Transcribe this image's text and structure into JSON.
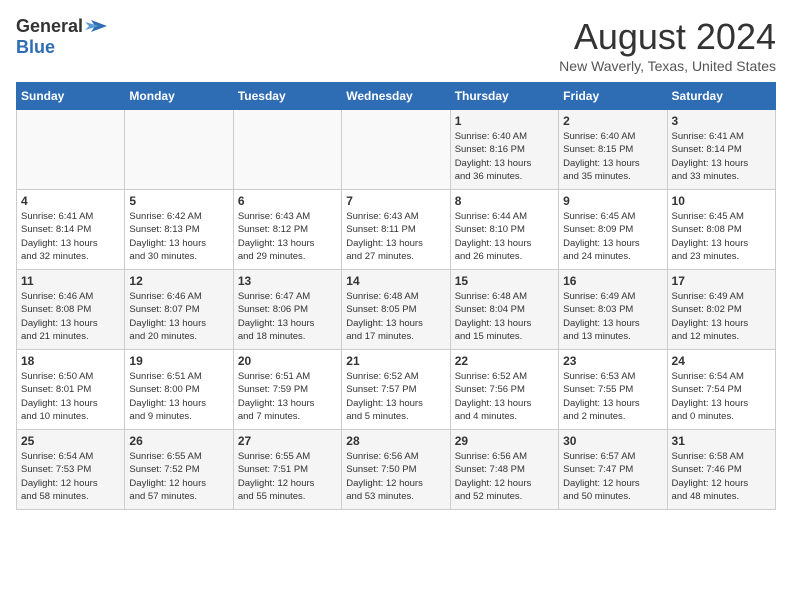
{
  "header": {
    "logo_general": "General",
    "logo_blue": "Blue",
    "month_title": "August 2024",
    "location": "New Waverly, Texas, United States"
  },
  "calendar": {
    "weekdays": [
      "Sunday",
      "Monday",
      "Tuesday",
      "Wednesday",
      "Thursday",
      "Friday",
      "Saturday"
    ],
    "weeks": [
      [
        {
          "day": "",
          "info": ""
        },
        {
          "day": "",
          "info": ""
        },
        {
          "day": "",
          "info": ""
        },
        {
          "day": "",
          "info": ""
        },
        {
          "day": "1",
          "info": "Sunrise: 6:40 AM\nSunset: 8:16 PM\nDaylight: 13 hours\nand 36 minutes."
        },
        {
          "day": "2",
          "info": "Sunrise: 6:40 AM\nSunset: 8:15 PM\nDaylight: 13 hours\nand 35 minutes."
        },
        {
          "day": "3",
          "info": "Sunrise: 6:41 AM\nSunset: 8:14 PM\nDaylight: 13 hours\nand 33 minutes."
        }
      ],
      [
        {
          "day": "4",
          "info": "Sunrise: 6:41 AM\nSunset: 8:14 PM\nDaylight: 13 hours\nand 32 minutes."
        },
        {
          "day": "5",
          "info": "Sunrise: 6:42 AM\nSunset: 8:13 PM\nDaylight: 13 hours\nand 30 minutes."
        },
        {
          "day": "6",
          "info": "Sunrise: 6:43 AM\nSunset: 8:12 PM\nDaylight: 13 hours\nand 29 minutes."
        },
        {
          "day": "7",
          "info": "Sunrise: 6:43 AM\nSunset: 8:11 PM\nDaylight: 13 hours\nand 27 minutes."
        },
        {
          "day": "8",
          "info": "Sunrise: 6:44 AM\nSunset: 8:10 PM\nDaylight: 13 hours\nand 26 minutes."
        },
        {
          "day": "9",
          "info": "Sunrise: 6:45 AM\nSunset: 8:09 PM\nDaylight: 13 hours\nand 24 minutes."
        },
        {
          "day": "10",
          "info": "Sunrise: 6:45 AM\nSunset: 8:08 PM\nDaylight: 13 hours\nand 23 minutes."
        }
      ],
      [
        {
          "day": "11",
          "info": "Sunrise: 6:46 AM\nSunset: 8:08 PM\nDaylight: 13 hours\nand 21 minutes."
        },
        {
          "day": "12",
          "info": "Sunrise: 6:46 AM\nSunset: 8:07 PM\nDaylight: 13 hours\nand 20 minutes."
        },
        {
          "day": "13",
          "info": "Sunrise: 6:47 AM\nSunset: 8:06 PM\nDaylight: 13 hours\nand 18 minutes."
        },
        {
          "day": "14",
          "info": "Sunrise: 6:48 AM\nSunset: 8:05 PM\nDaylight: 13 hours\nand 17 minutes."
        },
        {
          "day": "15",
          "info": "Sunrise: 6:48 AM\nSunset: 8:04 PM\nDaylight: 13 hours\nand 15 minutes."
        },
        {
          "day": "16",
          "info": "Sunrise: 6:49 AM\nSunset: 8:03 PM\nDaylight: 13 hours\nand 13 minutes."
        },
        {
          "day": "17",
          "info": "Sunrise: 6:49 AM\nSunset: 8:02 PM\nDaylight: 13 hours\nand 12 minutes."
        }
      ],
      [
        {
          "day": "18",
          "info": "Sunrise: 6:50 AM\nSunset: 8:01 PM\nDaylight: 13 hours\nand 10 minutes."
        },
        {
          "day": "19",
          "info": "Sunrise: 6:51 AM\nSunset: 8:00 PM\nDaylight: 13 hours\nand 9 minutes."
        },
        {
          "day": "20",
          "info": "Sunrise: 6:51 AM\nSunset: 7:59 PM\nDaylight: 13 hours\nand 7 minutes."
        },
        {
          "day": "21",
          "info": "Sunrise: 6:52 AM\nSunset: 7:57 PM\nDaylight: 13 hours\nand 5 minutes."
        },
        {
          "day": "22",
          "info": "Sunrise: 6:52 AM\nSunset: 7:56 PM\nDaylight: 13 hours\nand 4 minutes."
        },
        {
          "day": "23",
          "info": "Sunrise: 6:53 AM\nSunset: 7:55 PM\nDaylight: 13 hours\nand 2 minutes."
        },
        {
          "day": "24",
          "info": "Sunrise: 6:54 AM\nSunset: 7:54 PM\nDaylight: 13 hours\nand 0 minutes."
        }
      ],
      [
        {
          "day": "25",
          "info": "Sunrise: 6:54 AM\nSunset: 7:53 PM\nDaylight: 12 hours\nand 58 minutes."
        },
        {
          "day": "26",
          "info": "Sunrise: 6:55 AM\nSunset: 7:52 PM\nDaylight: 12 hours\nand 57 minutes."
        },
        {
          "day": "27",
          "info": "Sunrise: 6:55 AM\nSunset: 7:51 PM\nDaylight: 12 hours\nand 55 minutes."
        },
        {
          "day": "28",
          "info": "Sunrise: 6:56 AM\nSunset: 7:50 PM\nDaylight: 12 hours\nand 53 minutes."
        },
        {
          "day": "29",
          "info": "Sunrise: 6:56 AM\nSunset: 7:48 PM\nDaylight: 12 hours\nand 52 minutes."
        },
        {
          "day": "30",
          "info": "Sunrise: 6:57 AM\nSunset: 7:47 PM\nDaylight: 12 hours\nand 50 minutes."
        },
        {
          "day": "31",
          "info": "Sunrise: 6:58 AM\nSunset: 7:46 PM\nDaylight: 12 hours\nand 48 minutes."
        }
      ]
    ]
  }
}
